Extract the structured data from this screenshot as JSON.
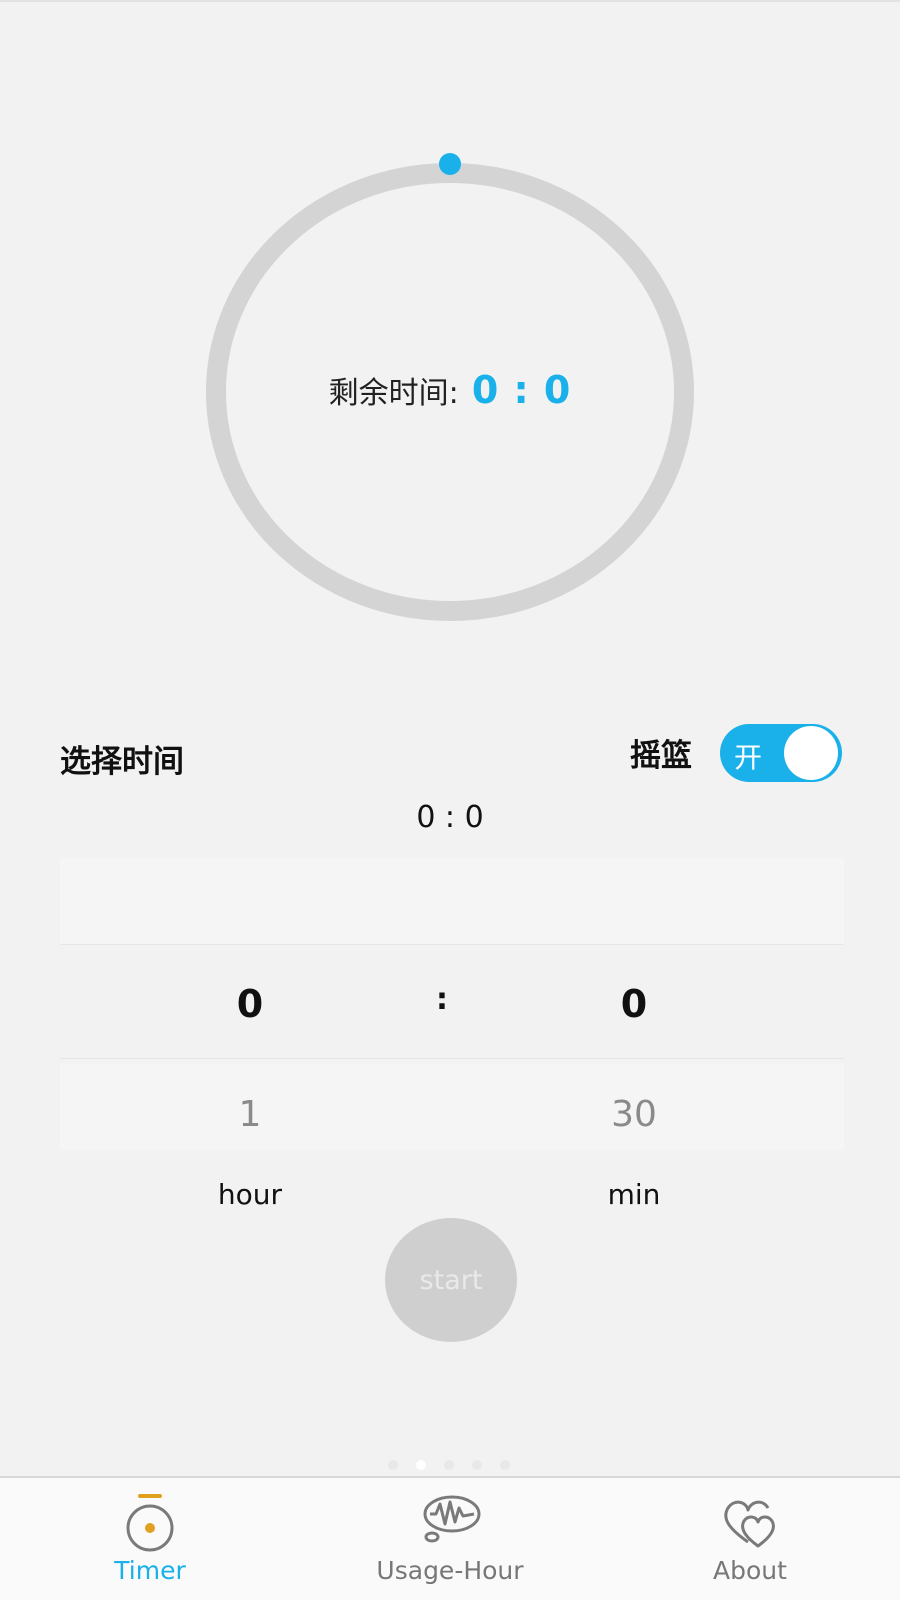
{
  "timer": {
    "remaining_label": "剩余时间:",
    "remaining_value": "0 : 0",
    "progress": 0,
    "accent_color": "#1ab0ea",
    "ring_color": "#d4d4d4"
  },
  "select": {
    "title": "选择时间",
    "cradle_label": "摇篮",
    "toggle_text": "开",
    "toggle_on": true,
    "selected_display": "0 : 0"
  },
  "picker": {
    "hour_selected": "0",
    "hour_next": "1",
    "separator": ":",
    "min_selected": "0",
    "min_next": "30",
    "hour_unit": "hour",
    "min_unit": "min"
  },
  "start_button": {
    "label": "start"
  },
  "page_indicator": {
    "count": 5,
    "active_index": 1
  },
  "nav": {
    "items": [
      {
        "label": "Timer",
        "icon": "timer-icon",
        "active": true,
        "color": "#1ab0ea"
      },
      {
        "label": "Usage-Hour",
        "icon": "thought-wave-icon",
        "active": false,
        "color": "#777777"
      },
      {
        "label": "About",
        "icon": "hearts-icon",
        "active": false,
        "color": "#777777"
      }
    ]
  }
}
